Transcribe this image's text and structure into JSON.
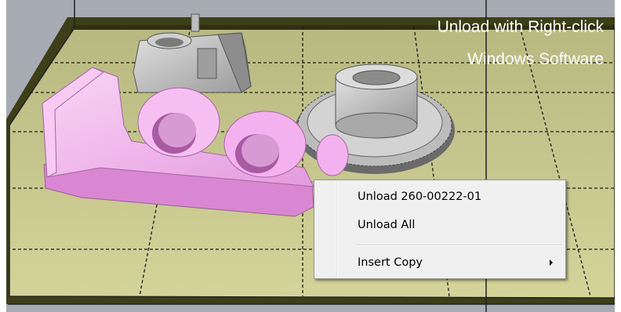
{
  "overlay": {
    "line1": "Unload with Right-click",
    "line2": "Windows Software"
  },
  "context_menu": {
    "items": [
      {
        "label": "Unload 260-00222-01",
        "has_submenu": false
      },
      {
        "label": "Unload All",
        "has_submenu": false
      },
      {
        "label": "Insert Copy",
        "has_submenu": true
      }
    ]
  },
  "scene": {
    "build_plate": "olive-green build plate with dashed grid",
    "parts": [
      "pink-bracket-part",
      "gray-gear-part",
      "gray-clamp-part"
    ]
  },
  "colors": {
    "background": "#a6abb4",
    "build_plate": "#c8c98c",
    "build_plate_dark": "#3f411b",
    "selected_part": "#f3b2ef",
    "unselected_part": "#c3c3c3",
    "overlay_text": "#ffffff",
    "menu_bg": "#f0f0f0"
  }
}
